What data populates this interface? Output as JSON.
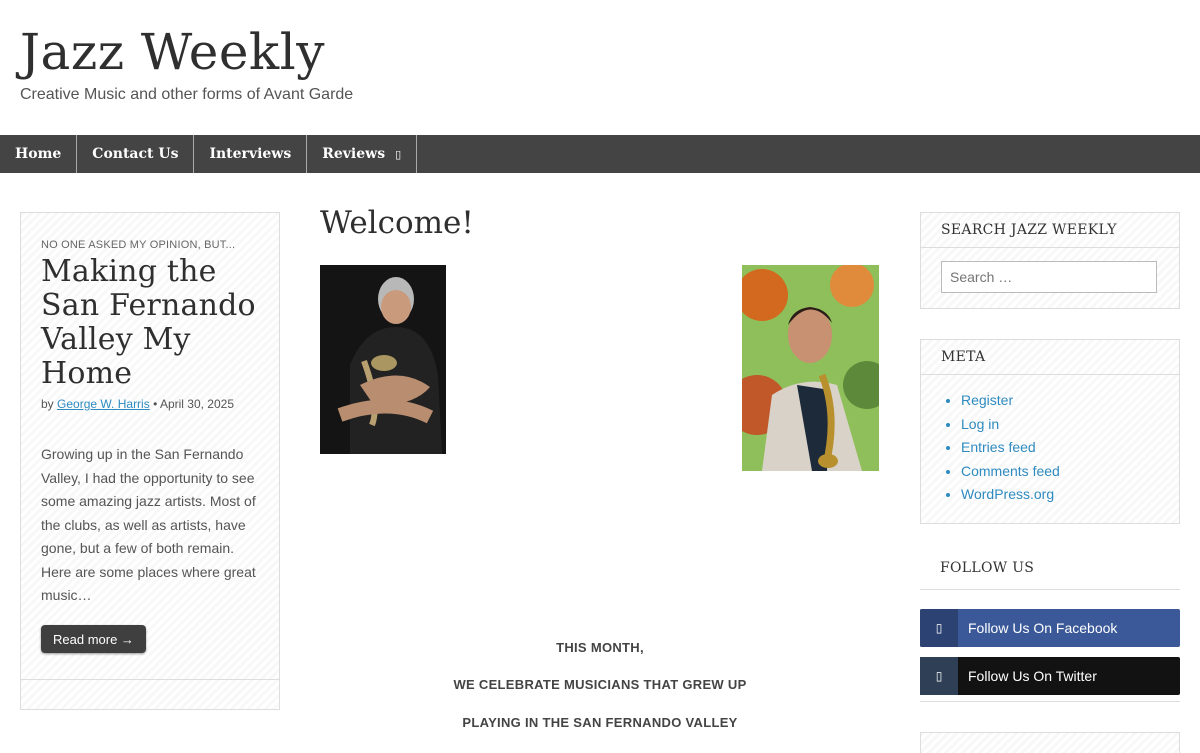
{
  "site": {
    "title": "Jazz Weekly",
    "tagline": "Creative Music and other forms of Avant Garde"
  },
  "nav": {
    "items": [
      {
        "label": "Home"
      },
      {
        "label": "Contact Us"
      },
      {
        "label": "Interviews"
      },
      {
        "label": "Reviews",
        "has_dropdown": true,
        "arrow_glyph": "▯"
      }
    ]
  },
  "featured_post": {
    "kicker": "NO ONE ASKED MY OPINION, BUT...",
    "title": "Making the San Fernando Valley My Home",
    "by": "by",
    "author": "George W. Harris",
    "separator": "•",
    "date": "April 30, 2025",
    "excerpt": "Growing up in the San Fernando Valley, I had the opportunity to see some amazing jazz artists. Most of the clubs, as well as artists, have gone, but a few of both remain. Here are some places where great music…",
    "read_more": "Read more →"
  },
  "main": {
    "heading": "Welcome!",
    "lines": [
      "THIS MONTH,",
      "WE CELEBRATE MUSICIANS THAT GREW UP",
      "PLAYING IN THE SAN FERNANDO VALLEY"
    ]
  },
  "sidebar": {
    "search": {
      "title": "SEARCH JAZZ WEEKLY",
      "placeholder": "Search …"
    },
    "meta": {
      "title": "META",
      "links": [
        "Register",
        "Log in",
        "Entries feed",
        "Comments feed",
        "WordPress.org"
      ]
    },
    "follow": {
      "title": "FOLLOW US",
      "facebook": {
        "label": "Follow Us On Facebook",
        "icon": "facebook-icon",
        "color": "#3b5998"
      },
      "twitter": {
        "label": "Follow Us On Twitter",
        "icon": "twitter-icon",
        "color": "#121212"
      }
    }
  },
  "colors": {
    "nav_bg": "#444444",
    "link": "#2e8bc0"
  }
}
